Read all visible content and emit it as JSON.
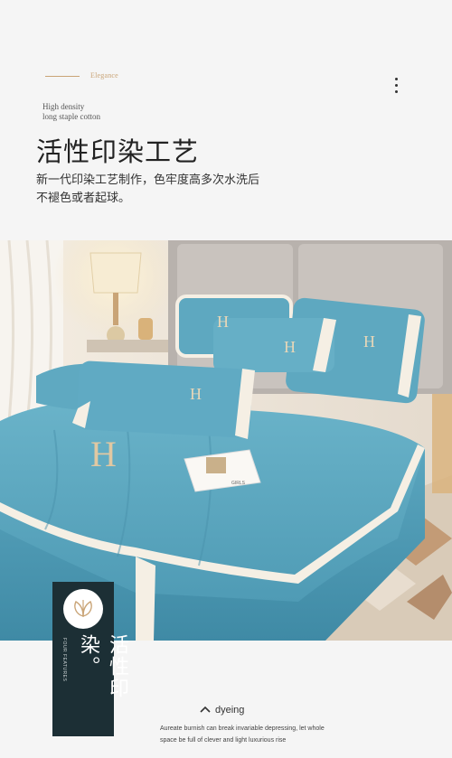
{
  "header": {
    "elegance": "Elegance",
    "sub_line1": "High density",
    "sub_line2": "long staple cotton",
    "title": "活性印染工艺",
    "desc_line1": "新一代印染工艺制作，色牢度高多次水洗后",
    "desc_line2": "不褪色或者起球。"
  },
  "badge": {
    "vertical_title": "活性印染。",
    "small_text": "FOUR FEATURES"
  },
  "footer": {
    "dyeing_label": "dyeing",
    "caption_line1": "Aureate burnish can break invariable depressing, let whole",
    "caption_line2": "space be full of clever and light luxurious rise"
  },
  "photo": {
    "pillow_letter": "H",
    "magazine_text": "GIRLS"
  },
  "colors": {
    "accent_gold": "#c9a476",
    "velvet_blue": "#5aa6bf",
    "badge_bg": "#1c2f35"
  }
}
